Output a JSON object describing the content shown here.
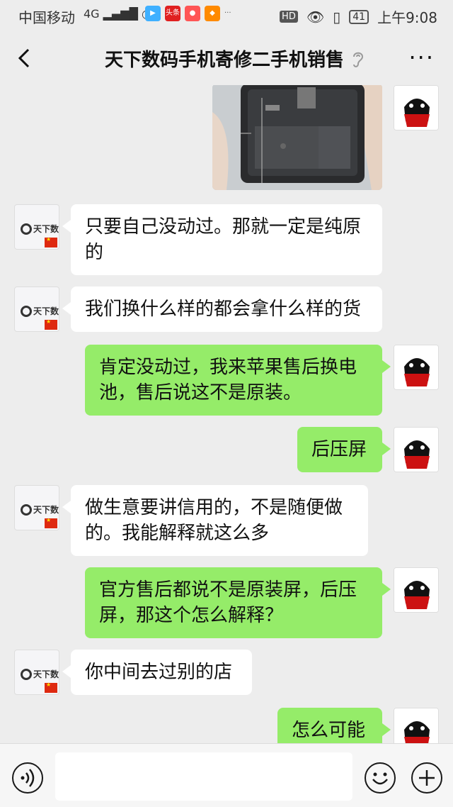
{
  "status_bar": {
    "carrier": "中国移动",
    "network": "4G",
    "time": "上午9:08",
    "battery": "41",
    "hd_label": "HD",
    "app_badges": [
      "头条"
    ]
  },
  "header": {
    "title": "天下数码手机寄修二手机销售",
    "back_icon": "chevron-left-icon",
    "more_icon": "more-dots-icon"
  },
  "messages": [
    {
      "from": "me",
      "type": "image",
      "desc": "phone-photo"
    },
    {
      "from": "shop",
      "type": "text",
      "text": "只要自己没动过。那就一定是纯原的"
    },
    {
      "from": "shop",
      "type": "text",
      "text": "我们换什么样的都会拿什么样的货"
    },
    {
      "from": "me",
      "type": "text",
      "text": "肯定没动过，我来苹果售后换电池，售后说这不是原装。"
    },
    {
      "from": "me",
      "type": "text",
      "text": "后压屏"
    },
    {
      "from": "shop",
      "type": "text",
      "text": "做生意要讲信用的，不是随便做的。我能解释就这么多"
    },
    {
      "from": "me",
      "type": "text",
      "text": "官方售后都说不是原装屏，后压屏，那这个怎么解释？"
    },
    {
      "from": "shop",
      "type": "text",
      "text": "你中间去过别的店"
    },
    {
      "from": "me",
      "type": "text",
      "text": "怎么可能"
    }
  ],
  "shop_avatar": {
    "logo_text": "天下数码"
  },
  "input_bar": {
    "voice_icon": "voice-icon",
    "emoji_icon": "emoji-icon",
    "plus_icon": "plus-icon",
    "text_value": ""
  },
  "colors": {
    "background": "#ededed",
    "bubble_in": "#ffffff",
    "bubble_out": "#95ec69"
  }
}
